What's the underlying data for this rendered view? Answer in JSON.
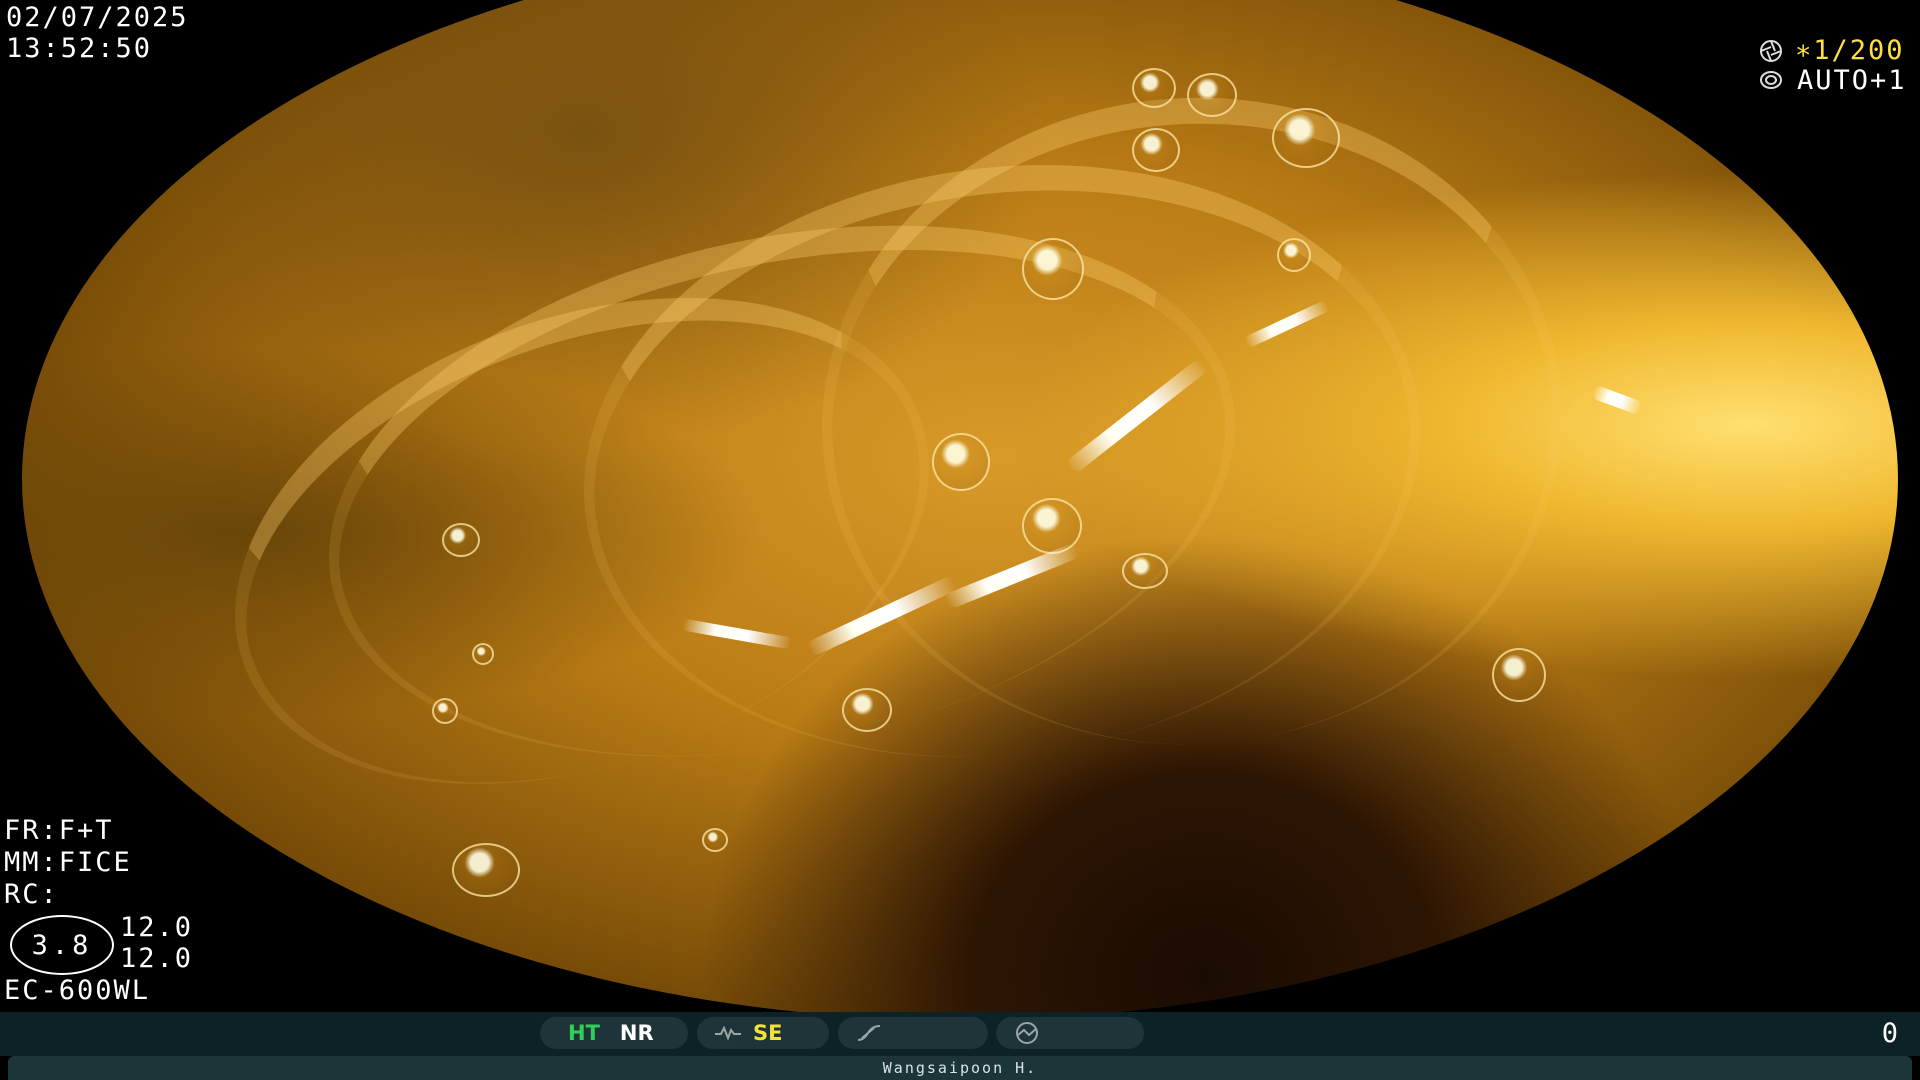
{
  "datetime": {
    "date": "02/07/2025",
    "time": "13:52:50"
  },
  "top_right": {
    "shutter": "∗1/200",
    "iris": "AUTO+1",
    "shutter_icon": "shutter-icon",
    "iris_icon": "iris-icon"
  },
  "settings": {
    "fr": "FR:F+T",
    "mm": "MM:FICE",
    "rc": "RC:",
    "circle_value": "3.8",
    "value_top": "12.0",
    "value_bottom": "12.0",
    "scope_model": "EC-600WL"
  },
  "status_bar": {
    "ht": "HT",
    "nr": "NR",
    "se": "SE",
    "counter": "0",
    "colors": {
      "ht": "#2fd05a",
      "nr": "#ffffff",
      "se": "#f2e23a"
    },
    "icons": [
      "structure-icon",
      "color-icon",
      "dial-icon"
    ]
  },
  "operator": "Wangsaipoon H."
}
